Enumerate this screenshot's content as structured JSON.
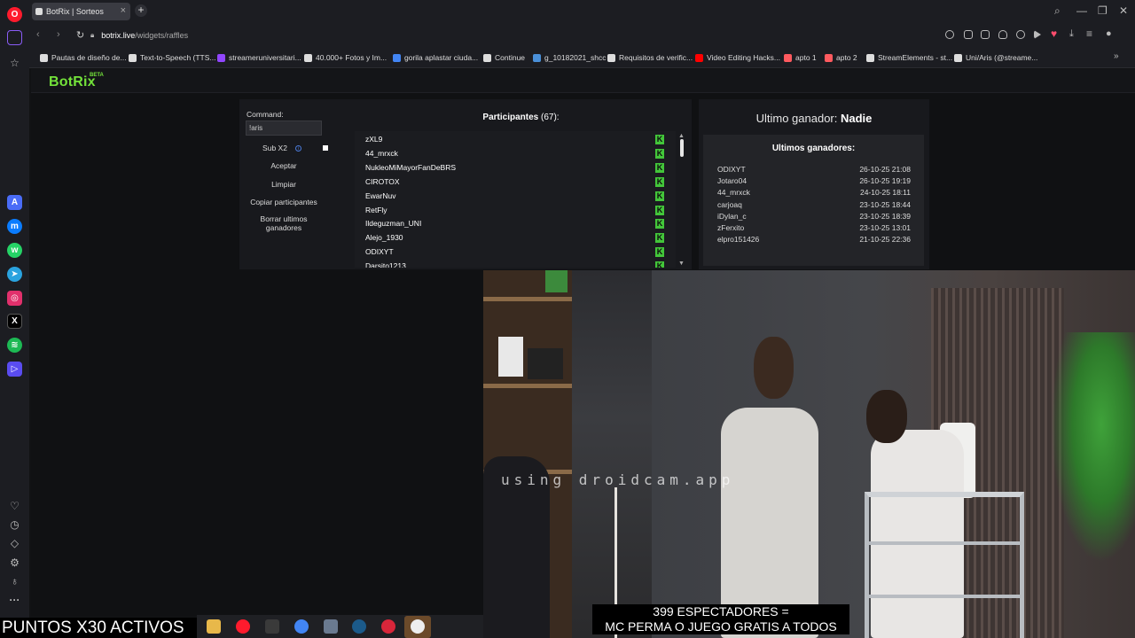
{
  "browser": {
    "tab_title": "BotRix | Sorteos",
    "tab_close": "×",
    "new_tab": "+",
    "url_host": "botrix.live",
    "url_path": "/widgets/raffles",
    "window_controls": [
      "⌕",
      "—",
      "❐",
      "✕"
    ]
  },
  "bookmarks": [
    {
      "label": "Pautas de diseño de...",
      "icon_color": "#dddddd"
    },
    {
      "label": "Text-to-Speech (TTS...",
      "icon_color": "#dddddd"
    },
    {
      "label": "streameruniversitari...",
      "icon_color": "#9146ff"
    },
    {
      "label": "40.000+ Fotos y Im...",
      "icon_color": "#dddddd"
    },
    {
      "label": "gorila aplastar ciuda...",
      "icon_color": "#4285f4"
    },
    {
      "label": "Continue",
      "icon_color": "#dddddd"
    },
    {
      "label": "g_10182021_shcc",
      "icon_color": "#4a90d9"
    },
    {
      "label": "Requisitos de verific...",
      "icon_color": "#dddddd"
    },
    {
      "label": "Video Editing Hacks...",
      "icon_color": "#ff0000"
    },
    {
      "label": "apto 1",
      "icon_color": "#ff5a5f"
    },
    {
      "label": "apto 2",
      "icon_color": "#ff5a5f"
    },
    {
      "label": "StreamElements - st...",
      "icon_color": "#dddddd"
    },
    {
      "label": "Uni/Aris (@streame...",
      "icon_color": "#dddddd"
    }
  ],
  "botrix": {
    "logo": "BotRix",
    "logo_badge": "BETA",
    "command_label": "Command:",
    "command_value": "!aris",
    "sub_label": "Sub X2",
    "sub_info": "i",
    "accept": "Aceptar",
    "clear": "Limpiar",
    "copy_participants": "Copiar participantes",
    "delete_winners": "Borrar ultimos ganadores",
    "participants_label": "Participantes",
    "participants_count": "(67):",
    "participants": [
      "zXL9",
      "44_mrxck",
      "NukleoMiMayorFanDeBRS",
      "CIROTOX",
      "EwarNuv",
      "RetFly",
      "Ildeguzman_UNI",
      "Alejo_1930",
      "ODIXYT",
      "Darsito1213"
    ],
    "kick_glyph": "K",
    "last_winner_label": "Ultimo ganador:",
    "last_winner_value": "Nadie",
    "recent_winners_title": "Ultimos ganadores:",
    "recent_winners": [
      {
        "name": "ODIXYT",
        "date": "26-10-25 21:08"
      },
      {
        "name": "Jotaro04",
        "date": "26-10-25 19:19"
      },
      {
        "name": "44_mrxck",
        "date": "24-10-25 18:11"
      },
      {
        "name": "carjoaq",
        "date": "23-10-25 18:44"
      },
      {
        "name": "iDylan_c",
        "date": "23-10-25 18:39"
      },
      {
        "name": "zFerxito",
        "date": "23-10-25 13:01"
      },
      {
        "name": "elpro151426",
        "date": "21-10-25 22:36"
      }
    ]
  },
  "stream": {
    "watermark": "using droidcam.app",
    "caption_line1": "399 ESPECTADORES =",
    "caption_line2": "MC PERMA O JUEGO GRATIS A TODOS",
    "points_banner": "PUNTOS X30 ACTIVOS"
  },
  "colors": {
    "brand_green": "#73e23a",
    "kick_green": "#43c63a",
    "opera_red": "#ff1b2d",
    "accent_purple": "#8a5cf6"
  }
}
